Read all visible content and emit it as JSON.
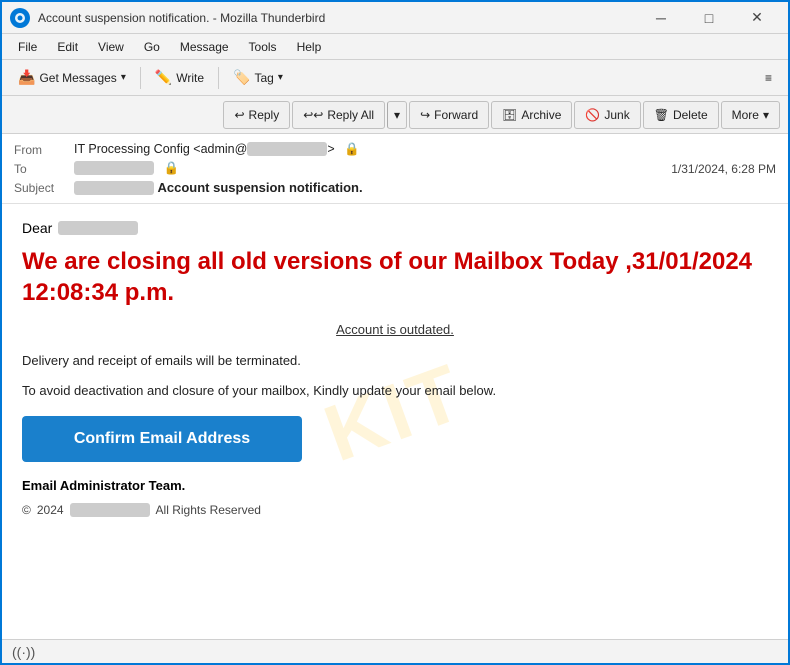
{
  "window": {
    "title": "Account suspension notification. - Mozilla Thunderbird",
    "icon": "T",
    "controls": {
      "minimize": "─",
      "maximize": "□",
      "close": "✕"
    }
  },
  "menubar": {
    "items": [
      "File",
      "Edit",
      "View",
      "Go",
      "Message",
      "Tools",
      "Help"
    ]
  },
  "toolbar": {
    "get_messages_label": "Get Messages",
    "write_label": "Write",
    "tag_label": "Tag",
    "hamburger": "≡"
  },
  "action_toolbar": {
    "reply_label": "Reply",
    "reply_all_label": "Reply All",
    "forward_label": "Forward",
    "archive_label": "Archive",
    "junk_label": "Junk",
    "delete_label": "Delete",
    "more_label": "More"
  },
  "email_header": {
    "from_label": "From",
    "from_name": "IT Processing Config <admin@",
    "from_suffix": ">",
    "to_label": "To",
    "to_value": "",
    "date": "1/31/2024, 6:28 PM",
    "subject_label": "Subject",
    "subject_prefix": "",
    "subject_value": "Account suspension notification."
  },
  "email_body": {
    "dear_label": "Dear",
    "dear_name": "",
    "headline": "We are closing all old versions of our Mailbox Today  ,31/01/2024 12:08:34 p.m.",
    "outdated_text": "Account is outdated.",
    "delivery_text": "Delivery and receipt of emails will be terminated.",
    "avoid_text": "To avoid deactivation and closure   of your mailbox, Kindly update your email below.",
    "confirm_button": "Confirm Email Address",
    "admin_team": "Email Administrator Team.",
    "copyright_symbol": "©",
    "copyright_year": "2024",
    "copyright_name": "",
    "copyright_suffix": "All Rights Reserved"
  },
  "statusbar": {
    "icon": "((·))"
  },
  "colors": {
    "accent_blue": "#0078d7",
    "headline_red": "#cc0000",
    "confirm_blue": "#1a80cc"
  }
}
